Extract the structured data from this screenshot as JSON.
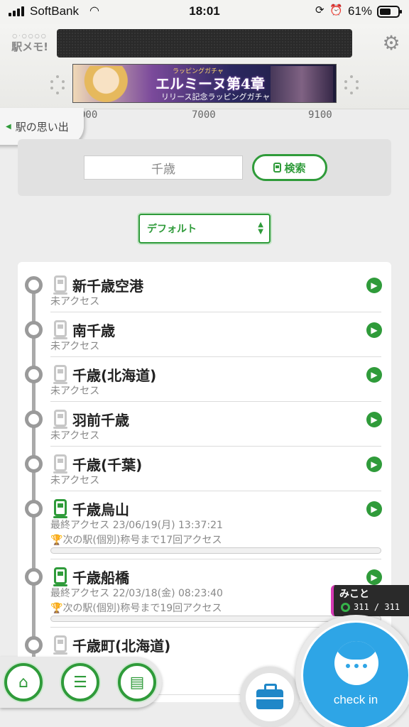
{
  "status_bar": {
    "carrier": "SoftBank",
    "time": "18:01",
    "battery_percent": "61%",
    "battery_level": 0.61
  },
  "header": {
    "logo_text": "駅メモ!",
    "banner": {
      "small_text": "ラッピングガチャ",
      "title": "エルミーヌ第4章",
      "subtitle": "リリース記念ラッピングガチャ"
    }
  },
  "scale": [
    "000",
    "7000",
    "9100"
  ],
  "memories_tab": {
    "label": "駅の思い出"
  },
  "search": {
    "input_value": "千歳",
    "button_label": "検索"
  },
  "sort": {
    "selected": "デフォルト"
  },
  "stations": [
    {
      "name": "新千歳空港",
      "status": "未アクセス",
      "visited": false
    },
    {
      "name": "南千歳",
      "status": "未アクセス",
      "visited": false
    },
    {
      "name": "千歳(北海道)",
      "status": "未アクセス",
      "visited": false
    },
    {
      "name": "羽前千歳",
      "status": "未アクセス",
      "visited": false
    },
    {
      "name": "千歳(千葉)",
      "status": "未アクセス",
      "visited": false
    },
    {
      "name": "千歳烏山",
      "status": "最終アクセス 23/06/19(月) 13:37:21",
      "next": "次の駅(個別)称号まで17回アクセス",
      "visited": true,
      "progress": 0.0
    },
    {
      "name": "千歳船橋",
      "status": "最終アクセス 22/03/18(金) 08:23:40",
      "next": "次の駅(個別)称号まで19回アクセス",
      "visited": true,
      "progress": 0.0
    },
    {
      "name": "千歳町(北海道)",
      "status": "",
      "visited": false
    }
  ],
  "user_badge": {
    "name": "みこと",
    "count": "311 / 311"
  },
  "checkin": {
    "label": "check in"
  },
  "colors": {
    "accent": "#2f9b3a",
    "checkin_blue": "#2ea5e6",
    "badge_pink": "#d63ab5"
  },
  "icons": [
    "home-icon",
    "menu-train-icon",
    "station-list-icon",
    "briefcase-icon",
    "gear-icon",
    "train-icon",
    "chevron-right-icon"
  ]
}
